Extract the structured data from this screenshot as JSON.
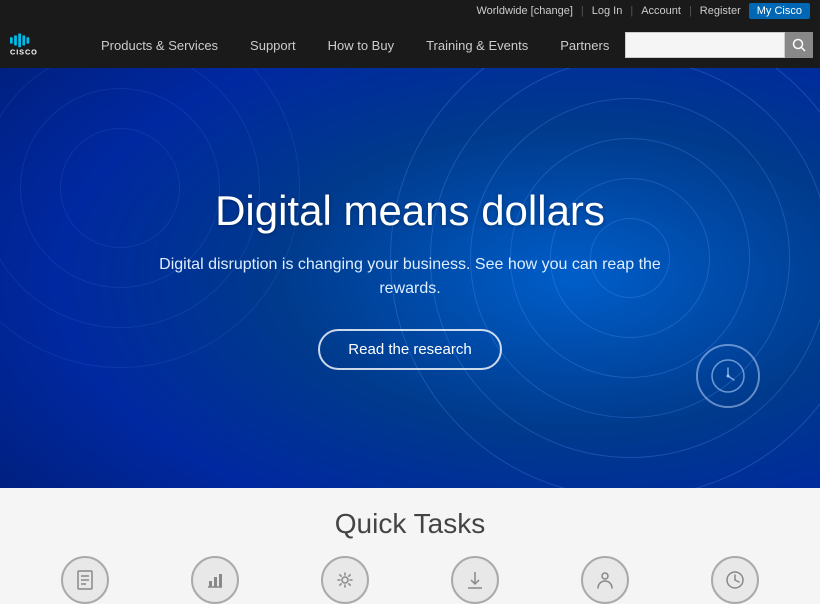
{
  "topbar": {
    "worldwide_label": "Worldwide [change]",
    "login_label": "Log In",
    "account_label": "Account",
    "register_label": "Register",
    "my_cisco_label": "My Cisco"
  },
  "nav": {
    "logo_alt": "Cisco",
    "items": [
      {
        "label": "Products & Services",
        "id": "products"
      },
      {
        "label": "Support",
        "id": "support"
      },
      {
        "label": "How to Buy",
        "id": "how-to-buy"
      },
      {
        "label": "Training & Events",
        "id": "training"
      },
      {
        "label": "Partners",
        "id": "partners"
      }
    ],
    "search_placeholder": ""
  },
  "hero": {
    "title": "Digital means dollars",
    "subtitle": "Digital disruption is changing your business. See how you can reap the rewards.",
    "cta_label": "Read the research"
  },
  "quick_tasks": {
    "title": "Quick Tasks",
    "icons": [
      {
        "name": "document-icon",
        "symbol": "📄"
      },
      {
        "name": "chart-icon",
        "symbol": "📈"
      },
      {
        "name": "gear-icon",
        "symbol": "⚙"
      },
      {
        "name": "download-icon",
        "symbol": "⬇"
      },
      {
        "name": "person-icon",
        "symbol": "👤"
      },
      {
        "name": "clock-icon",
        "symbol": "🕐"
      }
    ]
  },
  "colors": {
    "nav_bg": "#1a1a1a",
    "hero_bg": "#0047b3",
    "cta_border": "rgba(255,255,255,0.8)",
    "quick_bg": "#f5f5f5"
  }
}
